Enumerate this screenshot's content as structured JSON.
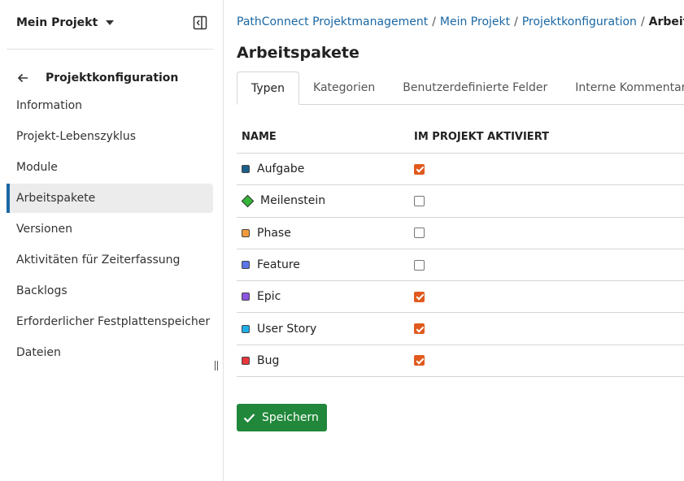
{
  "sidebar": {
    "project_name": "Mein Projekt",
    "back_label": "Projektkonfiguration",
    "items": [
      {
        "label": "Information"
      },
      {
        "label": "Projekt-Lebenszyklus"
      },
      {
        "label": "Module"
      },
      {
        "label": "Arbeitspakete",
        "active": true
      },
      {
        "label": "Versionen"
      },
      {
        "label": "Aktivitäten für Zeiterfassung"
      },
      {
        "label": "Backlogs"
      },
      {
        "label": "Erforderlicher Festplattenspeicher"
      },
      {
        "label": "Dateien"
      }
    ]
  },
  "breadcrumb": {
    "items": [
      "PathConnect Projektmanagement",
      "Mein Projekt",
      "Projektkonfiguration"
    ],
    "current": "Arbeitspa",
    "separator": "/"
  },
  "page": {
    "title": "Arbeitspakete"
  },
  "tabs": [
    {
      "label": "Typen",
      "active": true
    },
    {
      "label": "Kategorien"
    },
    {
      "label": "Benutzerdefinierte Felder"
    },
    {
      "label": "Interne Kommentare"
    }
  ],
  "table": {
    "columns": [
      "NAME",
      "IM PROJEKT AKTIVIERT"
    ],
    "rows": [
      {
        "name": "Aufgabe",
        "color": "#1a5f8a",
        "shape": "square",
        "enabled": true
      },
      {
        "name": "Meilenstein",
        "color": "#35b53a",
        "shape": "diamond",
        "enabled": false
      },
      {
        "name": "Phase",
        "color": "#f09a3c",
        "shape": "square",
        "enabled": false
      },
      {
        "name": "Feature",
        "color": "#5b74e8",
        "shape": "square",
        "enabled": false
      },
      {
        "name": "Epic",
        "color": "#8a55e0",
        "shape": "square",
        "enabled": true
      },
      {
        "name": "User Story",
        "color": "#20aee8",
        "shape": "square",
        "enabled": true
      },
      {
        "name": "Bug",
        "color": "#e8373c",
        "shape": "square",
        "enabled": true
      }
    ]
  },
  "actions": {
    "save_label": "Speichern"
  },
  "colors": {
    "link": "#1a67a3",
    "checkbox_checked": "#e05a1f",
    "save_button": "#21873a",
    "active_indicator": "#1a67a3"
  }
}
